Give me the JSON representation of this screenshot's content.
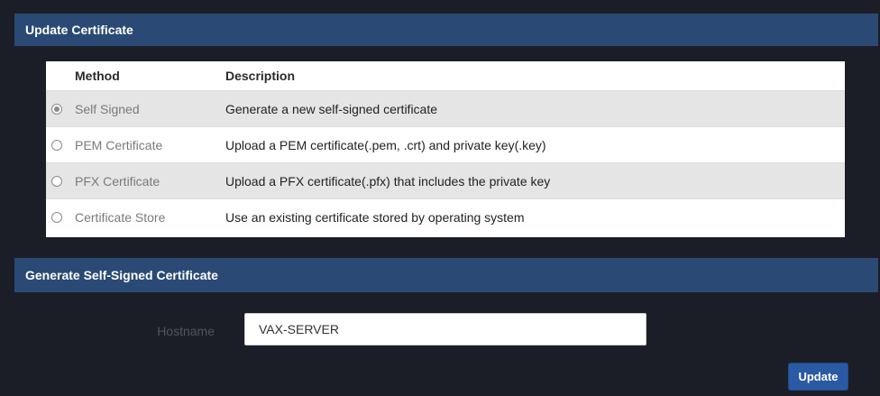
{
  "update_section": {
    "title": "Update Certificate"
  },
  "table": {
    "headers": {
      "method": "Method",
      "description": "Description"
    },
    "rows": [
      {
        "method": "Self Signed",
        "description": "Generate a new self-signed certificate",
        "selected": true
      },
      {
        "method": "PEM Certificate",
        "description": "Upload a PEM certificate(.pem, .crt) and private key(.key)",
        "selected": false
      },
      {
        "method": "PFX Certificate",
        "description": "Upload a PFX certificate(.pfx) that includes the private key",
        "selected": false
      },
      {
        "method": "Certificate Store",
        "description": "Use an existing certificate stored by operating system",
        "selected": false
      }
    ]
  },
  "generate_section": {
    "title": "Generate Self-Signed Certificate",
    "hostname_label": "Hostname",
    "hostname_value": "VAX-SERVER",
    "update_label": "Update"
  },
  "colors": {
    "page_background": "#1b1e26",
    "header_bar": "#2a4a75",
    "alt_row": "#e5e5e5",
    "button": "#2a5aa3"
  }
}
